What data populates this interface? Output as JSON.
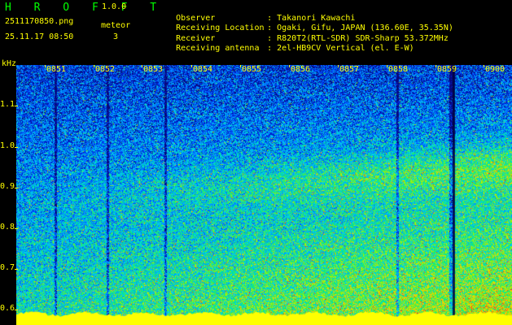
{
  "app": {
    "name": "H R O F F T",
    "version": "1.0.0",
    "filename": "2511170850.png",
    "timestamp": "25.11.17 08:50",
    "mode": "meteor",
    "count": "3"
  },
  "info": [
    {
      "key": "Observer",
      "value": "Takanori Kawachi"
    },
    {
      "key": "Receiving Location",
      "value": "Ogaki, Gifu, JAPAN (136.60E, 35.35N)"
    },
    {
      "key": "Receiver",
      "value": "R820T2(RTL-SDR) SDR-Sharp 53.372MHz"
    },
    {
      "key": "Receiving antenna",
      "value": "2el-HB9CV Vertical (el. E-W)"
    }
  ],
  "axis": {
    "y_unit": "kHz",
    "y_ticks": [
      "1.1",
      "1.0",
      "0.9",
      "0.8",
      "0.7",
      "0.6"
    ],
    "x_ticks": [
      "0851",
      "0852",
      "0853",
      "0854",
      "0855",
      "0856",
      "0857",
      "0858",
      "0859",
      "0900"
    ]
  },
  "colors": {
    "background": "#000000",
    "label": "#ffff00",
    "logo": "#00ff00",
    "baseline": "#ffff00"
  }
}
